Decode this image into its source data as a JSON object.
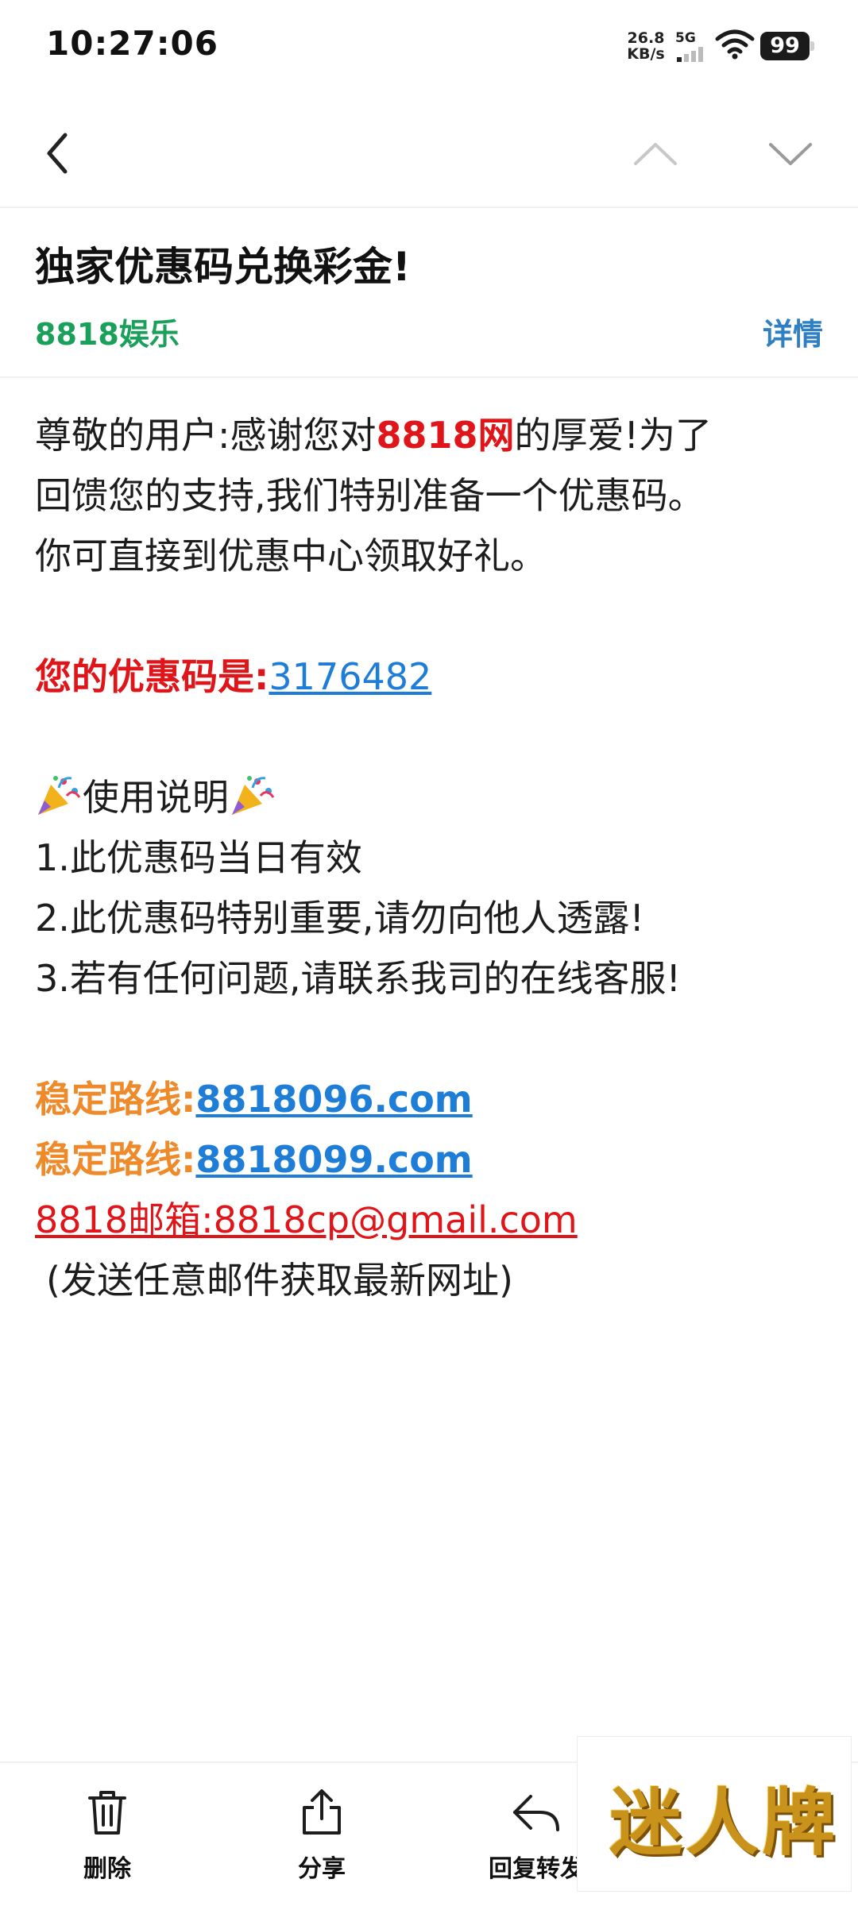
{
  "status_bar": {
    "time": "10:27:06",
    "net_speed_value": "26.8",
    "net_speed_unit": "KB/s",
    "network_type": "5G",
    "battery": "99"
  },
  "mail": {
    "subject": "独家优惠码兑换彩金!",
    "sender": "8818娱乐",
    "details_label": "详情"
  },
  "body": {
    "intro_a": "尊敬的用户:感谢您对",
    "intro_brand": "8818网",
    "intro_b": "的厚爱!为了",
    "intro_line2": "回馈您的支持,我们特别准备一个优惠码。",
    "intro_line3": "你可直接到优惠中心领取好礼。",
    "code_label": "您的优惠码是:",
    "code_value": "3176482",
    "usage_title": "使用说明",
    "rule1": "1.此优惠码当日有效",
    "rule2": "2.此优惠码特别重要,请勿向他人透露!",
    "rule3": "3.若有任何问题,请联系我司的在线客服!",
    "route_label_1": "稳定路线:",
    "route_url_1": "8818096.com",
    "route_label_2": "稳定路线:",
    "route_url_2": "8818099.com",
    "email_line": "8818邮箱:8818cp@gmail.com",
    "email_note": "(发送任意邮件获取最新网址)"
  },
  "bottom_bar": {
    "delete_label": "删除",
    "share_label": "分享",
    "reply_forward_label": "回复转发"
  },
  "watermark": {
    "text": "迷人牌"
  },
  "colors": {
    "sender_green": "#1aa05a",
    "link_blue": "#1e7dd6",
    "highlight_red": "#e0151a",
    "route_orange": "#ef8a2a"
  }
}
